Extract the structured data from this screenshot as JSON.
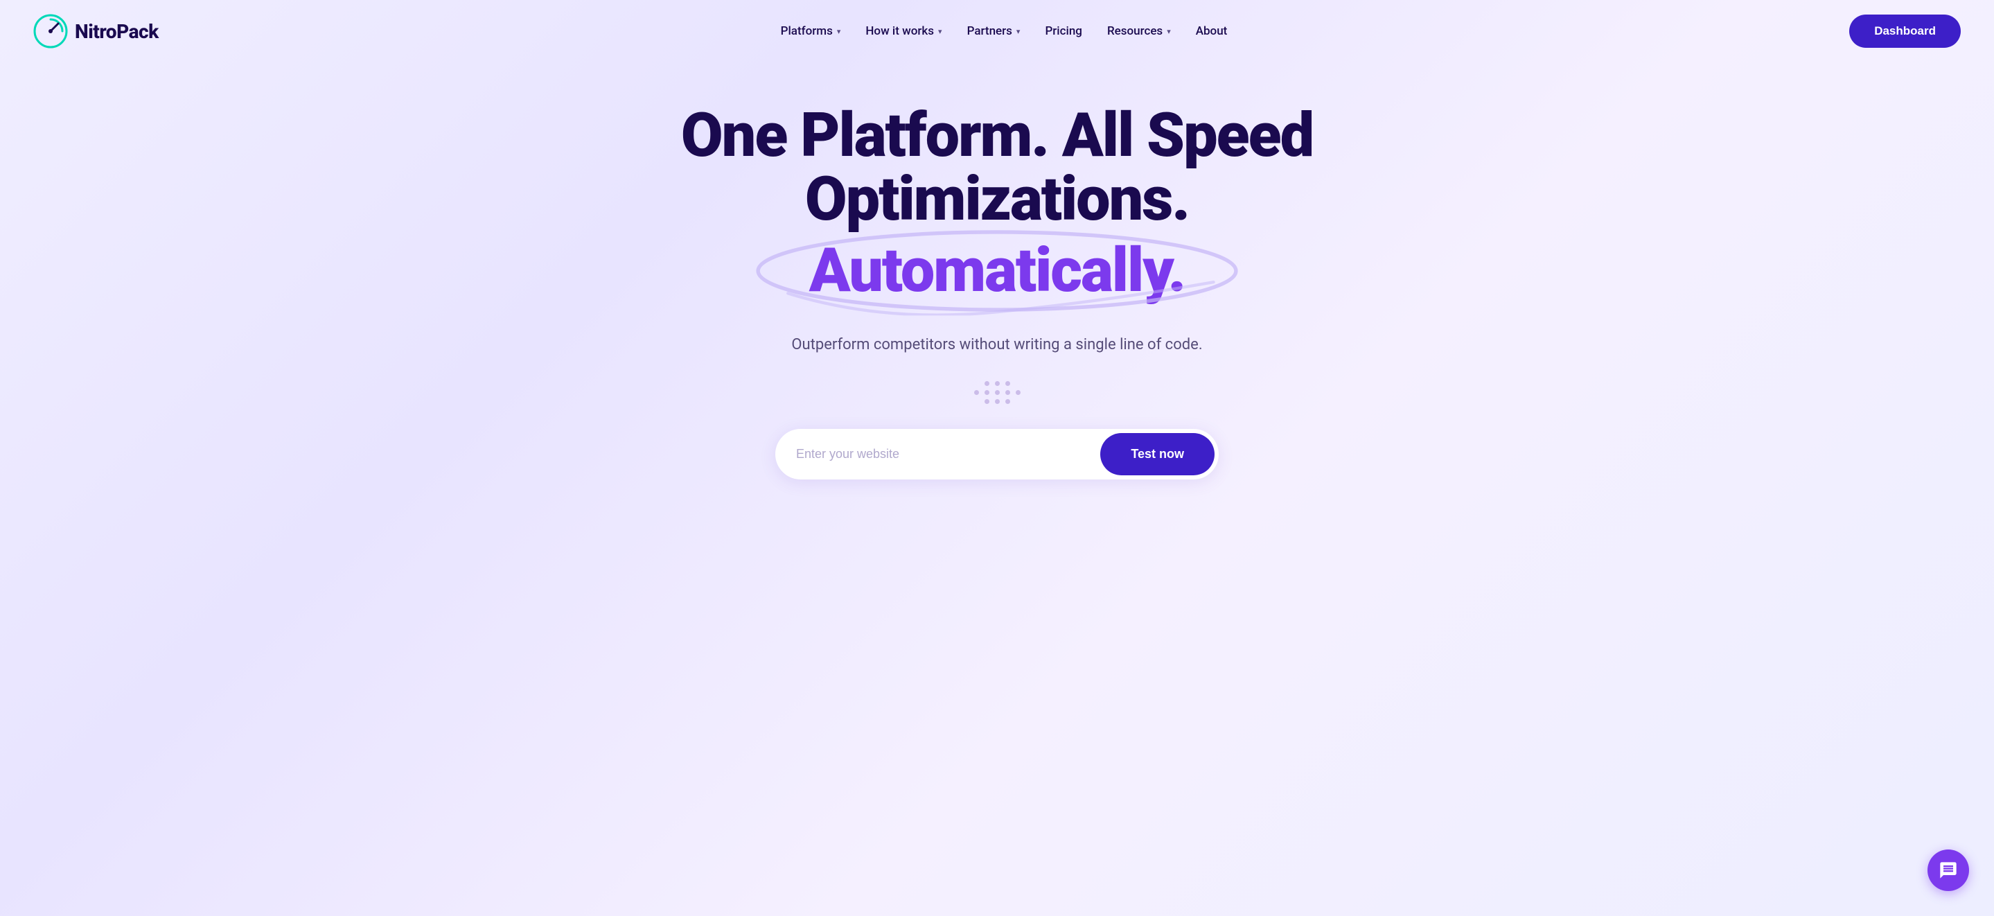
{
  "logo": {
    "text": "NitroPack",
    "alt": "NitroPack logo"
  },
  "nav": {
    "links": [
      {
        "label": "Platforms",
        "hasDropdown": true
      },
      {
        "label": "How it works",
        "hasDropdown": true
      },
      {
        "label": "Partners",
        "hasDropdown": true
      },
      {
        "label": "Pricing",
        "hasDropdown": false
      },
      {
        "label": "Resources",
        "hasDropdown": true
      },
      {
        "label": "About",
        "hasDropdown": false
      }
    ],
    "dashboard_label": "Dashboard"
  },
  "hero": {
    "line1": "One Platform.",
    "line2": "All Speed Optimizations.",
    "line3": "Automatically.",
    "subtitle": "Outperform competitors without writing a single line of code.",
    "input_placeholder": "Enter your website",
    "cta_label": "Test now"
  },
  "chat": {
    "label": "Chat support"
  }
}
